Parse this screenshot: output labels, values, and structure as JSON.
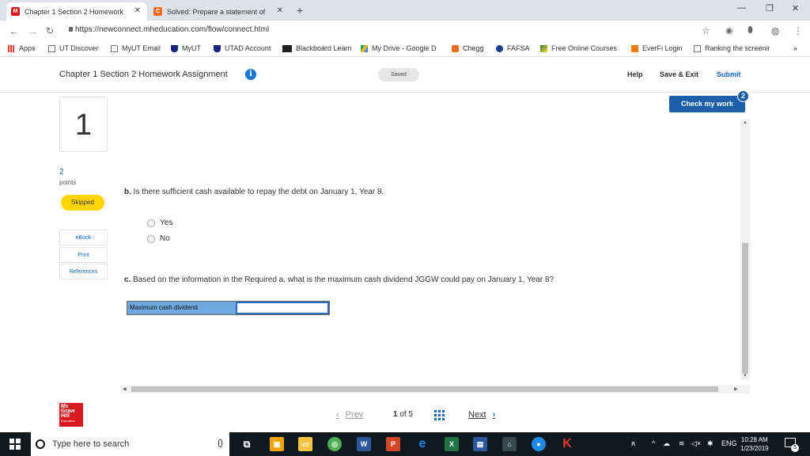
{
  "browser": {
    "tabs": [
      {
        "title": "Chapter 1 Section 2 Homework A",
        "active": true
      },
      {
        "title": "Solved: Prepare a statement of ca",
        "active": false
      }
    ],
    "url": "https://newconnect.mheducation.com/flow/connect.html",
    "bookmarks": [
      "Apps",
      "UT Discover",
      "MyUT Email",
      "MyUT",
      "UTAD Account",
      "Blackboard Learn",
      "My Drive - Google D",
      "Chegg",
      "FAFSA",
      "Free Online Courses",
      "EverFi Login",
      "Ranking the screenin"
    ],
    "bookmarks_overflow": "»"
  },
  "header": {
    "title": "Chapter 1 Section 2 Homework Assignment",
    "info_glyph": "i",
    "status": "Saved",
    "help": "Help",
    "save_exit": "Save & Exit",
    "submit": "Submit"
  },
  "question": {
    "number": "1",
    "points": "2",
    "points_label": "points",
    "status": "Skipped",
    "resources": [
      "eBook",
      "Print",
      "References"
    ],
    "part_b_letter": "b.",
    "part_b": "Is there sufficient cash available to repay the debt on January 1, Year 8.",
    "options": [
      "Yes",
      "No"
    ],
    "part_c_letter": "c.",
    "part_c": "Based on the information in the Required a, what is the maximum cash dividend JGGW could pay on January 1, Year 8?",
    "answer_label": "Maximum cash dividend",
    "answer_value": ""
  },
  "check_work": {
    "label": "Check my work",
    "count": "2"
  },
  "footer": {
    "logo_lines": [
      "Mc",
      "Graw",
      "Hill",
      "Education"
    ],
    "prev": "Prev",
    "page_current": "1",
    "page_of": "of",
    "page_total": "5",
    "next": "Next"
  },
  "taskbar": {
    "search_placeholder": "Type here to search",
    "language": "ENG",
    "time": "10:28 AM",
    "date": "1/23/2019",
    "notifications": "5"
  },
  "colors": {
    "brand_blue": "#1c5ea8",
    "skipped_yellow": "#ffd400",
    "mh_red": "#d71920",
    "answer_label_bg": "#6fa8dc"
  }
}
